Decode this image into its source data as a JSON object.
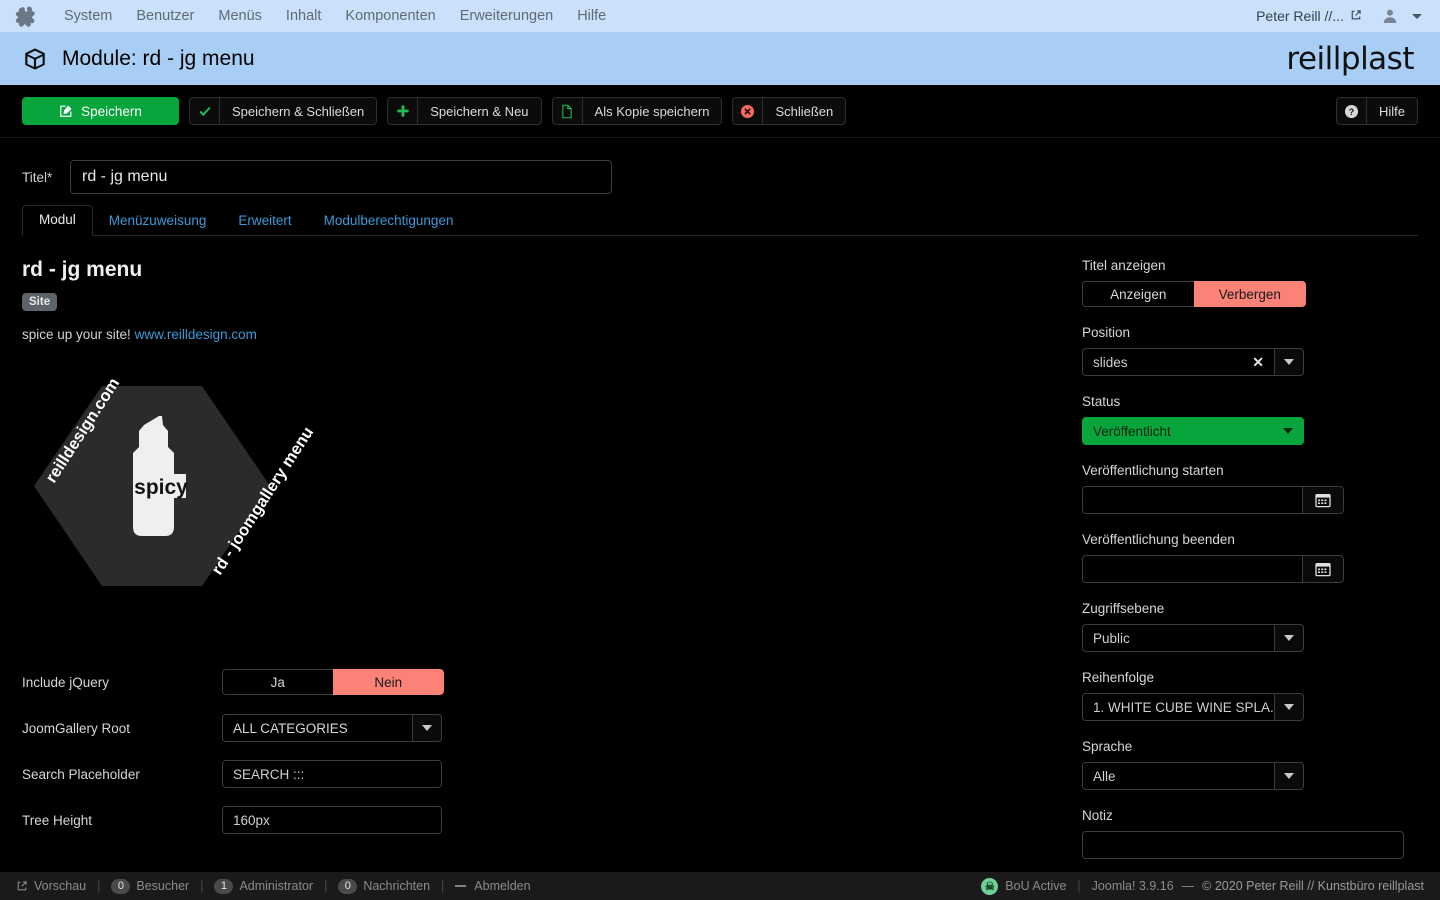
{
  "admin_menu": {
    "logo_alt": "Joomla",
    "items": [
      "System",
      "Benutzer",
      "Menüs",
      "Inhalt",
      "Komponenten",
      "Erweiterungen",
      "Hilfe"
    ],
    "user_label": "Peter Reill //..."
  },
  "header": {
    "title": "Module: rd - jg menu",
    "brand": "reillplast"
  },
  "toolbar": {
    "save": "Speichern",
    "save_close": "Speichern & Schließen",
    "save_new": "Speichern & Neu",
    "save_copy": "Als Kopie speichern",
    "close": "Schließen",
    "help": "Hilfe"
  },
  "form": {
    "title_label": "Titel",
    "title_required_mark": "*",
    "title_value": "rd - jg menu"
  },
  "tabs": [
    {
      "label": "Modul",
      "active": true
    },
    {
      "label": "Menüzuweisung",
      "active": false
    },
    {
      "label": "Erweitert",
      "active": false
    },
    {
      "label": "Modulberechtigungen",
      "active": false
    }
  ],
  "module_info": {
    "name": "rd - jg menu",
    "badge": "Site",
    "description_prefix": "spice up your site!",
    "description_link": "www.reilldesign.com",
    "logo": {
      "left_text": "reilldesign.com",
      "right_text": "rd - joomgallery menu",
      "bottle_text": "spicy"
    }
  },
  "left_options": [
    {
      "label": "Include jQuery",
      "type": "toggle",
      "options": [
        "Ja",
        "Nein"
      ],
      "selected": "Nein"
    },
    {
      "label": "JoomGallery Root",
      "type": "select",
      "value": "ALL CATEGORIES"
    },
    {
      "label": "Search Placeholder",
      "type": "text",
      "value": "SEARCH :::"
    },
    {
      "label": "Tree Height",
      "type": "text",
      "value": "160px"
    }
  ],
  "sidebar": {
    "show_title": {
      "label": "Titel anzeigen",
      "options": [
        "Anzeigen",
        "Verbergen"
      ],
      "selected": "Verbergen"
    },
    "position": {
      "label": "Position",
      "value": "slides"
    },
    "status": {
      "label": "Status",
      "value": "Veröffentlicht"
    },
    "publish_start": {
      "label": "Veröffentlichung starten",
      "value": ""
    },
    "publish_end": {
      "label": "Veröffentlichung beenden",
      "value": ""
    },
    "access": {
      "label": "Zugriffsebene",
      "value": "Public"
    },
    "ordering": {
      "label": "Reihenfolge",
      "value": "1. WHITE CUBE WINE SPLA..."
    },
    "language": {
      "label": "Sprache",
      "value": "Alle"
    },
    "note": {
      "label": "Notiz",
      "value": ""
    }
  },
  "footer": {
    "preview": "Vorschau",
    "visitors_count": "0",
    "visitors_label": "Besucher",
    "admins_count": "1",
    "admins_label": "Administrator",
    "messages_count": "0",
    "messages_label": "Nachrichten",
    "logout": "Abmelden",
    "bou": "BoU Active",
    "version": "Joomla! 3.9.16",
    "dash": "—",
    "copyright": "© 2020 Peter Reill // Kunstbüro reillplast"
  },
  "colors": {
    "accent_green": "#07a53b",
    "accent_red": "#fa8277",
    "header_blue": "#a8cef6",
    "menu_blue": "#cbe0fa",
    "link_blue": "#3a9ad9"
  }
}
